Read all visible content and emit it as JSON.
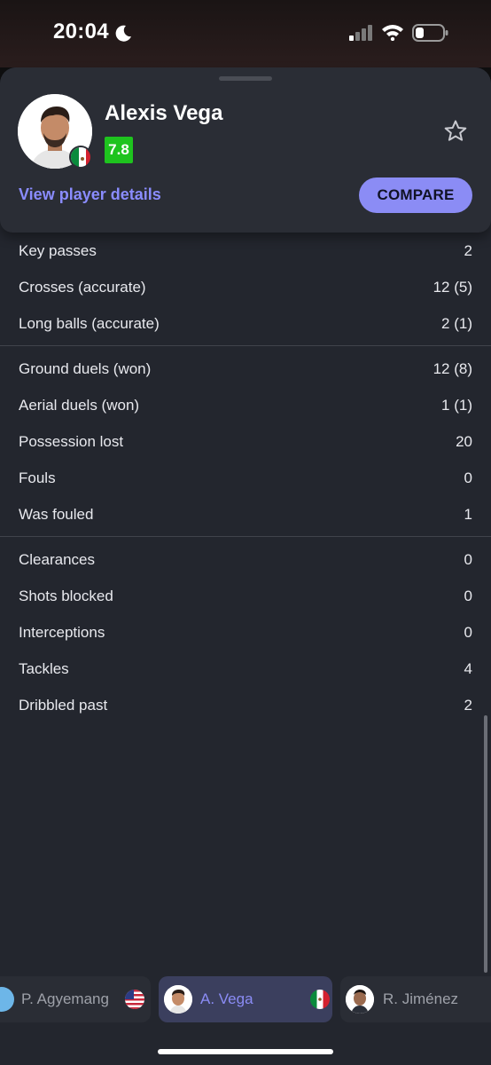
{
  "status_bar": {
    "time": "20:04"
  },
  "player": {
    "name": "Alexis Vega",
    "rating": "7.8",
    "details_link": "View player details",
    "compare_label": "COMPARE"
  },
  "stats": {
    "group1": [
      {
        "label": "Key passes",
        "value": "2"
      },
      {
        "label": "Crosses (accurate)",
        "value": "12 (5)"
      },
      {
        "label": "Long balls (accurate)",
        "value": "2 (1)"
      }
    ],
    "group2": [
      {
        "label": "Ground duels (won)",
        "value": "12 (8)"
      },
      {
        "label": "Aerial duels (won)",
        "value": "1 (1)"
      },
      {
        "label": "Possession lost",
        "value": "20"
      },
      {
        "label": "Fouls",
        "value": "0"
      },
      {
        "label": "Was fouled",
        "value": "1"
      }
    ],
    "group3": [
      {
        "label": "Clearances",
        "value": "0"
      },
      {
        "label": "Shots blocked",
        "value": "0"
      },
      {
        "label": "Interceptions",
        "value": "0"
      },
      {
        "label": "Tackles",
        "value": "4"
      },
      {
        "label": "Dribbled past",
        "value": "2"
      }
    ]
  },
  "player_selector": [
    {
      "name": "P. Agyemang",
      "flag": "usa-flag-icon"
    },
    {
      "name": "A. Vega",
      "flag": "mexico-flag-icon",
      "active": true
    },
    {
      "name": "R. Jiménez",
      "flag": "mexico-flag-icon"
    }
  ],
  "colors": {
    "accent": "#8b8cf5",
    "rating_green": "#1ec31e",
    "sheet_bg": "#23262e"
  }
}
